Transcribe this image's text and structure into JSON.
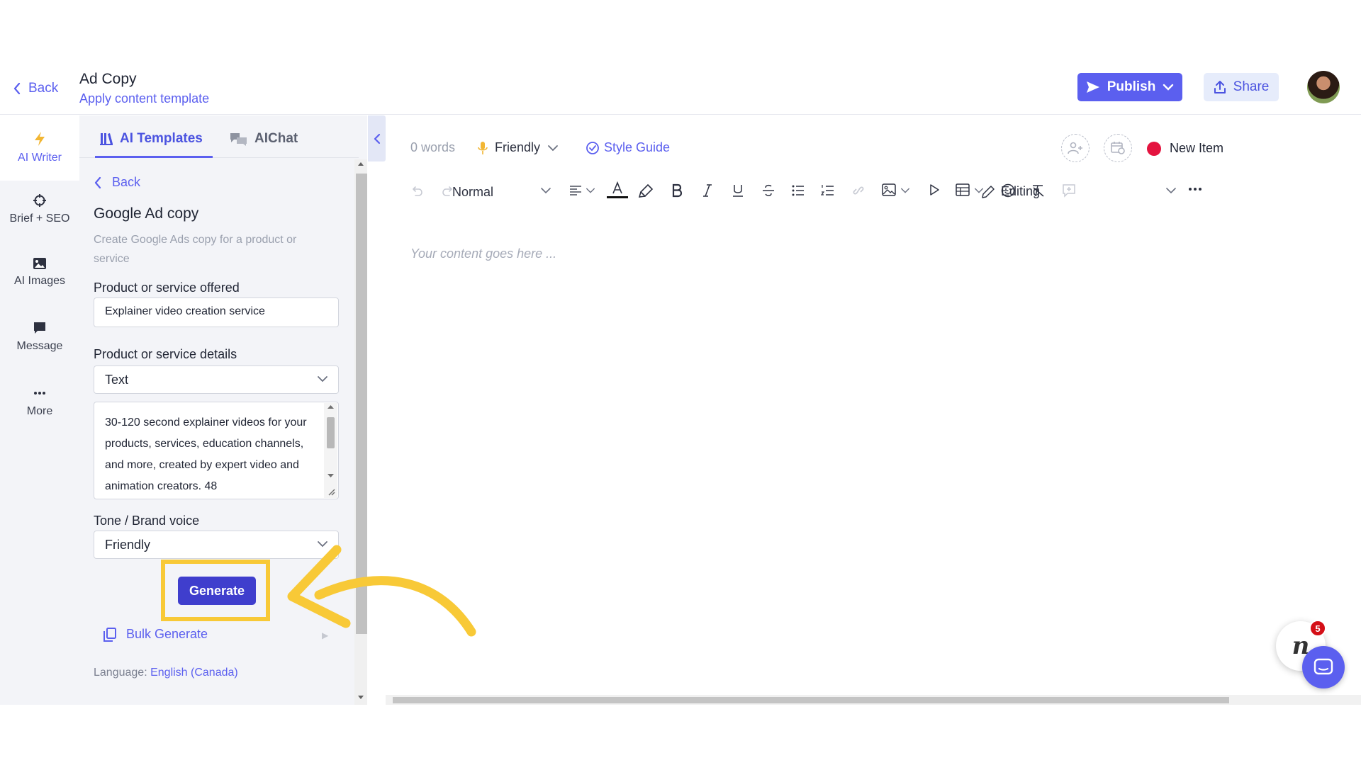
{
  "header": {
    "back_label": "Back",
    "title": "Ad Copy",
    "subtitle": "Apply content template",
    "publish_label": "Publish",
    "share_label": "Share"
  },
  "rail": {
    "items": [
      {
        "label": "AI Writer",
        "icon": "lightning-icon",
        "active": true
      },
      {
        "label": "Brief + SEO",
        "icon": "crosshair-icon"
      },
      {
        "label": "AI Images",
        "icon": "image-icon"
      },
      {
        "label": "Message",
        "icon": "message-icon"
      },
      {
        "label": "More",
        "icon": "ellipsis-icon"
      }
    ]
  },
  "panel": {
    "tabs": [
      {
        "label": "AI Templates",
        "icon": "library-icon",
        "active": true
      },
      {
        "label": "AIChat",
        "icon": "chat-bubbles-icon"
      }
    ],
    "back_label": "Back",
    "template_title": "Google Ad copy",
    "template_description": "Create Google Ads copy for a product or service",
    "fields": {
      "product_label": "Product or service offered",
      "product_value": "Explainer video creation service",
      "details_label": "Product or service details",
      "details_type": "Text",
      "details_value": "30-120 second explainer videos for your products, services, education channels, and more, created by expert video and animation creators. 48",
      "tone_label": "Tone / Brand voice",
      "tone_value": "Friendly"
    },
    "generate_label": "Generate",
    "bulk_generate_label": "Bulk Generate",
    "language_prefix": "Language:",
    "language_value": "English (Canada)"
  },
  "editor": {
    "word_count": "0 words",
    "tone": "Friendly",
    "style_guide_label": "Style Guide",
    "status_label": "New Item",
    "status_color": "#e4133f",
    "block_style": "Normal",
    "mode_label": "Editing",
    "placeholder": "Your content goes here ..."
  },
  "notification": {
    "badge_count": "5",
    "bubble_letter": "n"
  },
  "colors": {
    "accent": "#5b5fef",
    "generate_button": "#3f3ecd",
    "highlight": "#f8c937"
  }
}
